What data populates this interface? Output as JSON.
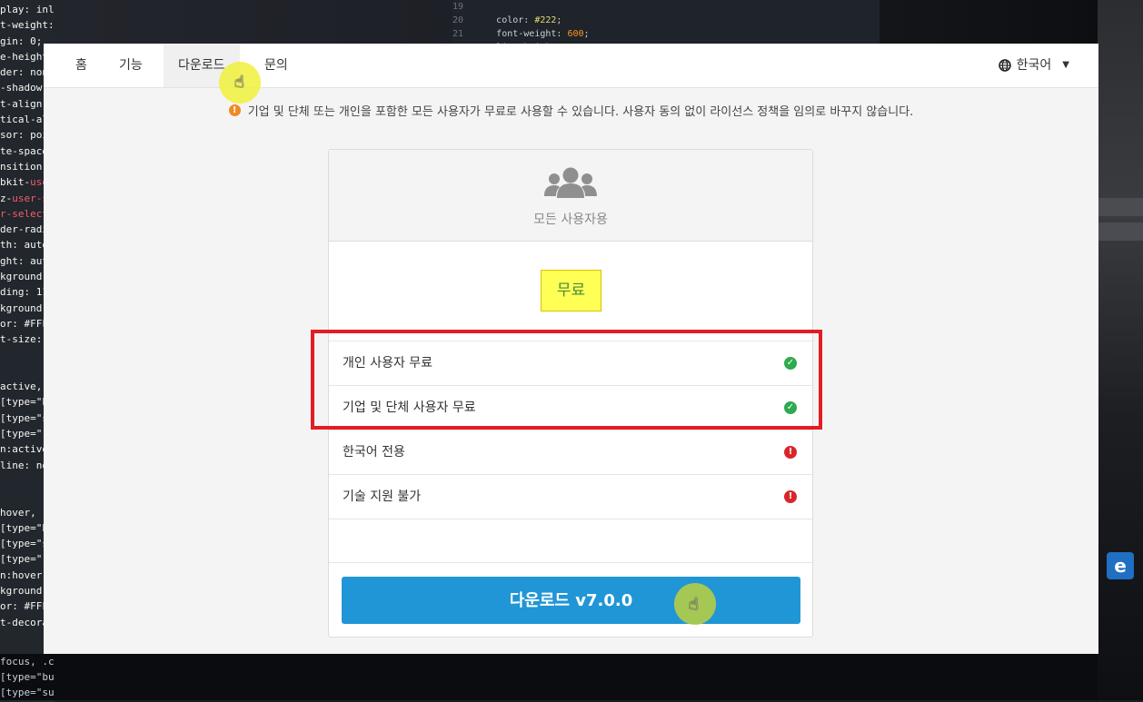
{
  "nav": {
    "items": [
      {
        "label": "홈"
      },
      {
        "label": "기능"
      },
      {
        "label": "다운로드"
      },
      {
        "label": "문의"
      }
    ],
    "language": "한국어"
  },
  "notice": {
    "text": "기업 및 단체 또는 개인을 포함한 모든 사용자가 무료로 사용할 수 있습니다. 사용자 동의 없이 라이선스 정책을 임의로 바꾸지 않습니다."
  },
  "card": {
    "audience": "모든 사용자용",
    "price": "무료",
    "features": [
      {
        "label": "개인 사용자 무료",
        "status": "included"
      },
      {
        "label": "기업 및 단체 사용자 무료",
        "status": "included"
      },
      {
        "label": "한국어 전용",
        "status": "limitation"
      },
      {
        "label": "기술 지원 불가",
        "status": "limitation"
      }
    ],
    "download_label": "다운로드 v7.0.0"
  },
  "colors": {
    "accent": "#2196d6",
    "ok": "#2eaa4f",
    "no": "#d9262b",
    "warning": "#f08a24",
    "highlight_box": "#e21d24",
    "price_bg": "#ffff55"
  }
}
